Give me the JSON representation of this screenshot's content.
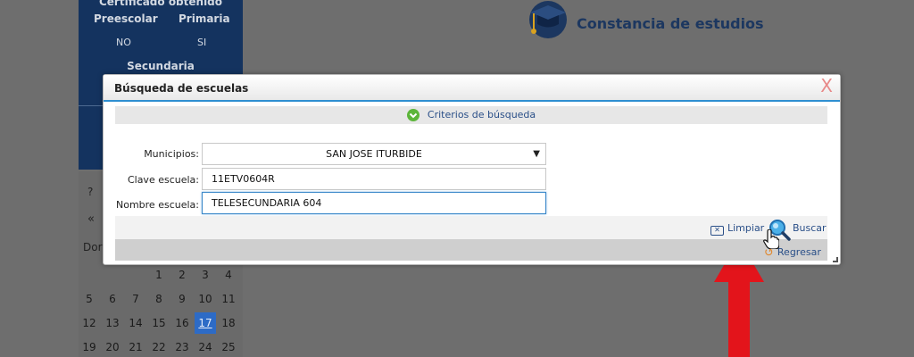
{
  "background": {
    "certificate": {
      "title": "Certificado obtenido",
      "preescolar_label": "Preescolar",
      "primaria_label": "Primaria",
      "preescolar_value": "NO",
      "primaria_value": "SI",
      "secundaria_label": "Secundaria"
    },
    "header": {
      "title": "Constancia de estudios",
      "icon": "graduation-cap-icon"
    },
    "calendar": {
      "help": "?",
      "prev": "«",
      "first_day_label": "Dor",
      "days": [
        [
          "",
          "",
          "",
          "1",
          "2",
          "3",
          "4"
        ],
        [
          "5",
          "6",
          "7",
          "8",
          "9",
          "10",
          "11"
        ],
        [
          "12",
          "13",
          "14",
          "15",
          "16",
          "17",
          "18"
        ],
        [
          "19",
          "20",
          "21",
          "22",
          "23",
          "24",
          "25"
        ]
      ],
      "today": "17"
    }
  },
  "modal": {
    "title": "Búsqueda de escuelas",
    "close_label": "X",
    "criteria_label": "Criterios de búsqueda",
    "fields": {
      "municipio_label": "Municipios:",
      "municipio_value": "SAN JOSE ITURBIDE",
      "clave_label": "Clave escuela:",
      "clave_value": "11ETV0604R",
      "nombre_label": "Nombre escuela:",
      "nombre_value": "TELESECUNDARIA 604"
    },
    "buttons": {
      "limpiar": "Limpiar",
      "buscar": "Buscar",
      "regresar": "Regresar"
    }
  },
  "colors": {
    "navy": "#14335f",
    "accent_blue": "#2f8fd1",
    "link_blue": "#2a4f88",
    "annotation_red": "#e3141b"
  }
}
